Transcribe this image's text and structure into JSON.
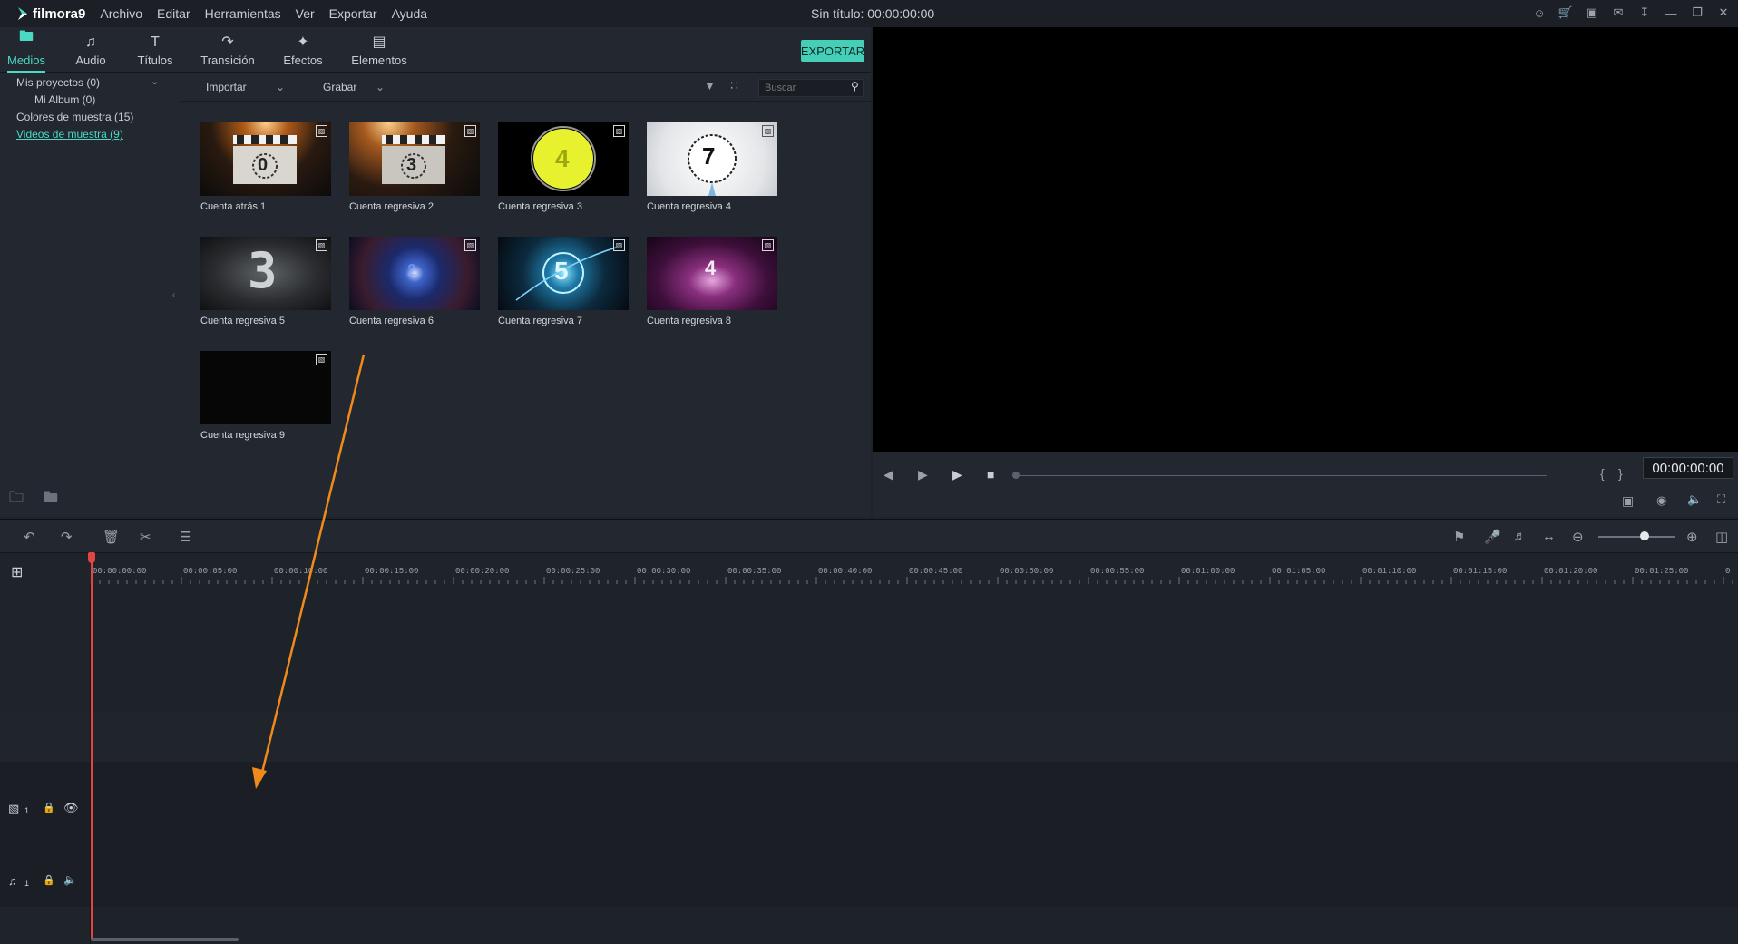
{
  "app": {
    "name": "filmora9",
    "window_title": "Sin título: 00:00:00:00"
  },
  "menu": [
    "Archivo",
    "Editar",
    "Herramientas",
    "Ver",
    "Exportar",
    "Ayuda"
  ],
  "tabs": [
    {
      "label": "Medios",
      "icon": "folder-icon"
    },
    {
      "label": "Audio",
      "icon": "music-note-icon"
    },
    {
      "label": "Títulos",
      "icon": "text-icon"
    },
    {
      "label": "Transición",
      "icon": "transition-icon"
    },
    {
      "label": "Efectos",
      "icon": "effects-icon"
    },
    {
      "label": "Elementos",
      "icon": "image-icon"
    }
  ],
  "export_label": "EXPORTAR",
  "sidebar": {
    "items": [
      {
        "label": "Mis proyectos (0)"
      },
      {
        "label": "Mi Album (0)"
      },
      {
        "label": "Colores de muestra (15)"
      },
      {
        "label": "Videos de muestra (9)"
      }
    ]
  },
  "media_toolbar": {
    "import_label": "Importar",
    "record_label": "Grabar",
    "search_placeholder": "Buscar"
  },
  "media_items": [
    {
      "label": "Cuenta atrás 1",
      "digit": "0"
    },
    {
      "label": "Cuenta regresiva 2",
      "digit": "3"
    },
    {
      "label": "Cuenta regresiva 3",
      "digit": "4"
    },
    {
      "label": "Cuenta regresiva 4",
      "digit": "7"
    },
    {
      "label": "Cuenta regresiva 5",
      "digit": "3"
    },
    {
      "label": "Cuenta regresiva 6",
      "digit": "2"
    },
    {
      "label": "Cuenta regresiva 7",
      "digit": "5"
    },
    {
      "label": "Cuenta regresiva 8",
      "digit": "4"
    },
    {
      "label": "Cuenta regresiva 9",
      "digit": ""
    }
  ],
  "preview": {
    "timecode": "00:00:00:00",
    "brace_left": "{",
    "brace_right": "}"
  },
  "ruler_labels": [
    "00:00:00:00",
    "00:00:05:00",
    "00:00:10:00",
    "00:00:15:00",
    "00:00:20:00",
    "00:00:25:00",
    "00:00:30:00",
    "00:00:35:00",
    "00:00:40:00",
    "00:00:45:00",
    "00:00:50:00",
    "00:00:55:00",
    "00:01:00:00",
    "00:01:05:00",
    "00:01:10:00",
    "00:01:15:00",
    "00:01:20:00",
    "00:01:25:00",
    "0"
  ],
  "tracks": {
    "video_number": "1",
    "audio_number": "1"
  },
  "colors": {
    "accent": "#4ad9c3",
    "playhead": "#e2463e",
    "annotation_arrow": "#f08a1c"
  }
}
